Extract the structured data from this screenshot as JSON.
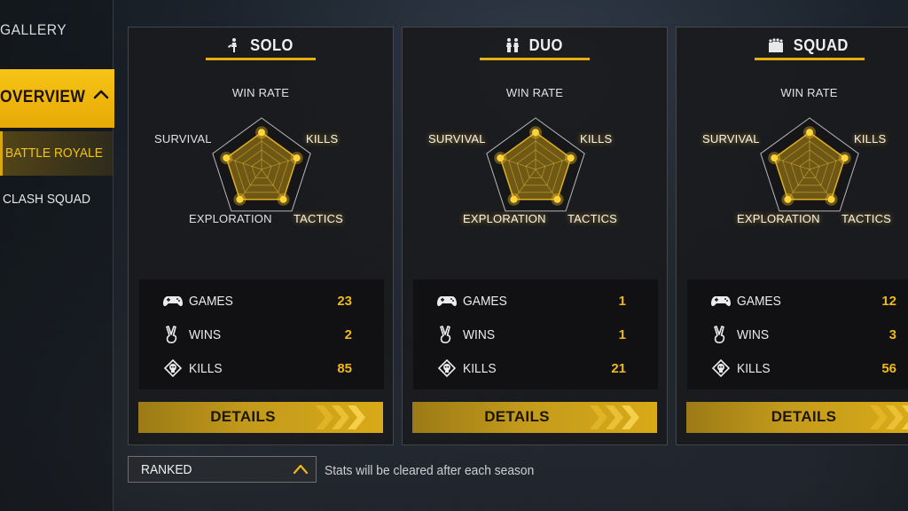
{
  "sidebar": {
    "gallery_label": "GALLERY",
    "overview_label": "OVERVIEW",
    "items": [
      {
        "label": "BATTLE ROYALE",
        "active": true
      },
      {
        "label": "CLASH SQUAD",
        "active": false
      }
    ]
  },
  "radar_labels": {
    "win_rate": "WIN RATE",
    "kills": "KILLS",
    "tactics": "TACTICS",
    "exploration": "EXPLORATION",
    "survival": "SURVIVAL"
  },
  "cards": [
    {
      "title": "SOLO",
      "icon": "solo-icon",
      "stats": [
        {
          "label": "GAMES",
          "value": "23",
          "icon": "gamepad-icon"
        },
        {
          "label": "WINS",
          "value": "2",
          "icon": "victory-hand-icon"
        },
        {
          "label": "KILLS",
          "value": "85",
          "icon": "skull-icon"
        }
      ],
      "details_label": "DETAILS"
    },
    {
      "title": "DUO",
      "icon": "duo-icon",
      "stats": [
        {
          "label": "GAMES",
          "value": "1",
          "icon": "gamepad-icon"
        },
        {
          "label": "WINS",
          "value": "1",
          "icon": "victory-hand-icon"
        },
        {
          "label": "KILLS",
          "value": "21",
          "icon": "skull-icon"
        }
      ],
      "details_label": "DETAILS"
    },
    {
      "title": "SQUAD",
      "icon": "squad-icon",
      "stats": [
        {
          "label": "GAMES",
          "value": "12",
          "icon": "gamepad-icon"
        },
        {
          "label": "WINS",
          "value": "3",
          "icon": "victory-hand-icon"
        },
        {
          "label": "KILLS",
          "value": "56",
          "icon": "skull-icon"
        }
      ],
      "details_label": "DETAILS"
    }
  ],
  "mode_select": {
    "value": "RANKED"
  },
  "season_note": "Stats will be cleared after each season",
  "colors": {
    "accent": "#f0b81a",
    "accent_dark": "#9c7a16",
    "panel": "#1a1b1e"
  }
}
